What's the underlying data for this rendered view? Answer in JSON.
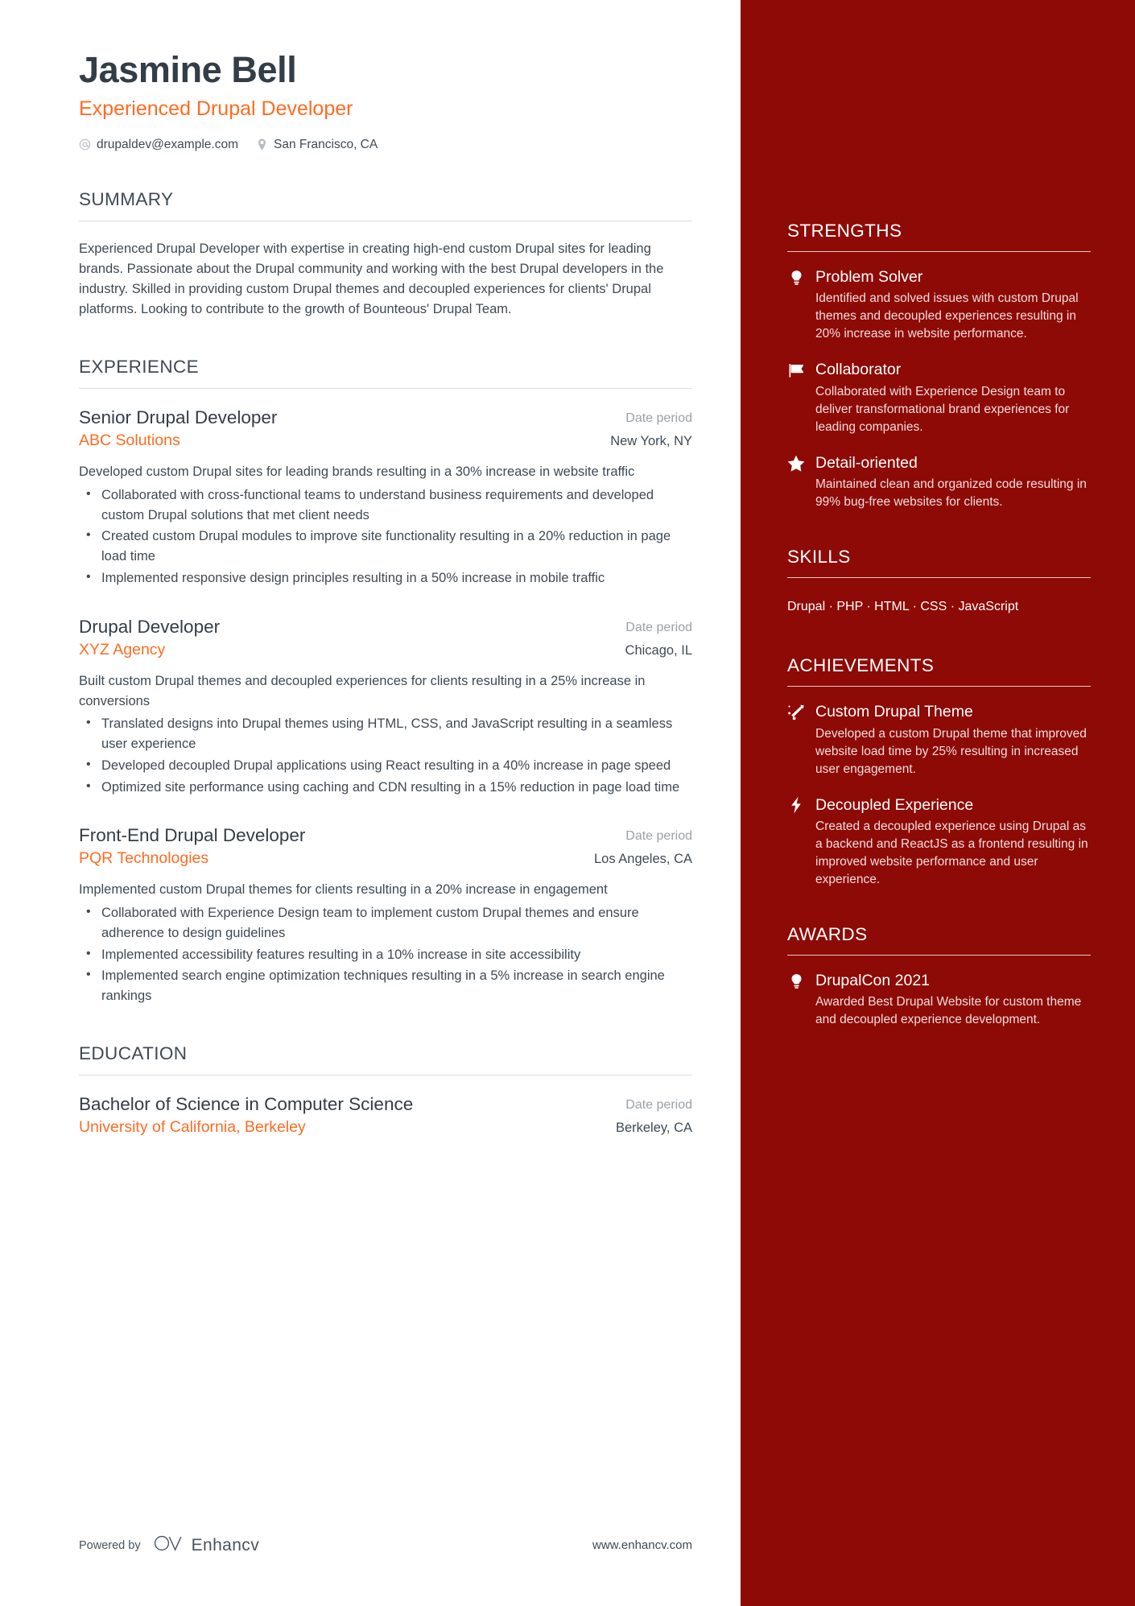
{
  "header": {
    "name": "Jasmine Bell",
    "job_title": "Experienced Drupal Developer",
    "email": "drupaldev@example.com",
    "location": "San Francisco, CA",
    "email_icon": "at-icon",
    "location_icon": "map-pin-icon"
  },
  "colors": {
    "accent_orange": "#ff6b22",
    "sidebar_red": "#8d0a06",
    "heading_dark": "#333d47",
    "body_text": "#3f4a54",
    "muted": "#9aa1a8"
  },
  "summary": {
    "heading": "SUMMARY",
    "text": "Experienced Drupal Developer with expertise in creating high-end custom Drupal sites for leading brands. Passionate about the Drupal community and working with the best Drupal developers in the industry. Skilled in providing custom Drupal themes and decoupled experiences for clients' Drupal platforms. Looking to contribute to the growth of Bounteous' Drupal Team."
  },
  "experience": {
    "heading": "EXPERIENCE",
    "entries": [
      {
        "title": "Senior Drupal Developer",
        "date": "Date period",
        "org": "ABC Solutions",
        "location": "New York, NY",
        "description": "Developed custom Drupal sites for leading brands resulting in a 30% increase in website traffic",
        "bullets": [
          "Collaborated with cross-functional teams to understand business requirements and developed custom Drupal solutions that met client needs",
          "Created custom Drupal modules to improve site functionality resulting in a 20% reduction in page load time",
          "Implemented responsive design principles resulting in a 50% increase in mobile traffic"
        ]
      },
      {
        "title": "Drupal Developer",
        "date": "Date period",
        "org": "XYZ Agency",
        "location": "Chicago, IL",
        "description": "Built custom Drupal themes and decoupled experiences for clients resulting in a 25% increase in conversions",
        "bullets": [
          "Translated designs into Drupal themes using HTML, CSS, and JavaScript resulting in a seamless user experience",
          "Developed decoupled Drupal applications using React resulting in a 40% increase in page speed",
          "Optimized site performance using caching and CDN resulting in a 15% reduction in page load time"
        ]
      },
      {
        "title": "Front-End Drupal Developer",
        "date": "Date period",
        "org": "PQR Technologies",
        "location": "Los Angeles, CA",
        "description": "Implemented custom Drupal themes for clients resulting in a 20% increase in engagement",
        "bullets": [
          "Collaborated with Experience Design team to implement custom Drupal themes and ensure adherence to design guidelines",
          "Implemented accessibility features resulting in a 10% increase in site accessibility",
          "Implemented search engine optimization techniques resulting in a 5% increase in search engine rankings"
        ]
      }
    ]
  },
  "education": {
    "heading": "EDUCATION",
    "entries": [
      {
        "title": "Bachelor of Science in Computer Science",
        "date": "Date period",
        "org": "University of California, Berkeley",
        "location": "Berkeley, CA"
      }
    ]
  },
  "footer": {
    "powered_by": "Powered by",
    "brand": "Enhancv",
    "url": "www.enhancv.com",
    "brand_icon": "enhancv-logo-icon"
  },
  "sidebar": {
    "strengths": {
      "heading": "STRENGTHS",
      "items": [
        {
          "icon": "lightbulb-icon",
          "title": "Problem Solver",
          "desc": "Identified and solved issues with custom Drupal themes and decoupled experiences resulting in 20% increase in website performance."
        },
        {
          "icon": "flag-icon",
          "title": "Collaborator",
          "desc": "Collaborated with Experience Design team to deliver transformational brand experiences for leading companies."
        },
        {
          "icon": "star-icon",
          "title": "Detail-oriented",
          "desc": "Maintained clean and organized code resulting in 99% bug-free websites for clients."
        }
      ]
    },
    "skills": {
      "heading": "SKILLS",
      "list": [
        "Drupal",
        "PHP",
        "HTML",
        "CSS",
        "JavaScript"
      ],
      "text": "Drupal · PHP · HTML · CSS · JavaScript"
    },
    "achievements": {
      "heading": "ACHIEVEMENTS",
      "items": [
        {
          "icon": "rocket-icon",
          "title": "Custom Drupal Theme",
          "desc": "Developed a custom Drupal theme that improved website load time by 25% resulting in increased user engagement."
        },
        {
          "icon": "lightning-bolt-icon",
          "title": "Decoupled Experience",
          "desc": "Created a decoupled experience using Drupal as a backend and ReactJS as a frontend resulting in improved website performance and user experience."
        }
      ]
    },
    "awards": {
      "heading": "AWARDS",
      "items": [
        {
          "icon": "lightbulb-icon",
          "title": "DrupalCon 2021",
          "desc": "Awarded Best Drupal Website for custom theme and decoupled experience development."
        }
      ]
    }
  }
}
